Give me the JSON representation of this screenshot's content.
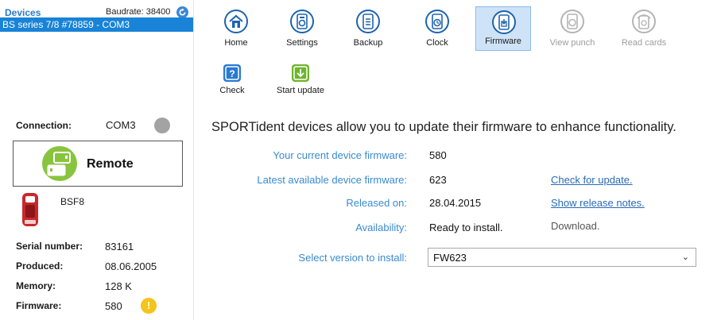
{
  "left_panel": {
    "devices_title": "Devices",
    "baudrate_label": "Baudrate: 38400",
    "selected_device": "BS series 7/8 #78859 - COM3",
    "connection": {
      "label": "Connection:",
      "value": "COM3",
      "status_color": "#a3a3a3"
    },
    "mode_label": "Remote",
    "device_model": "BSF8",
    "info": {
      "serial_label": "Serial number:",
      "serial_value": "83161",
      "produced_label": "Produced:",
      "produced_value": "08.06.2005",
      "memory_label": "Memory:",
      "memory_value": "128 K",
      "firmware_label": "Firmware:",
      "firmware_value": "580",
      "warning_symbol": "!"
    }
  },
  "toolbar": {
    "items": [
      {
        "label": "Home",
        "icon": "home-icon",
        "state": "normal"
      },
      {
        "label": "Settings",
        "icon": "settings-icon",
        "state": "normal"
      },
      {
        "label": "Backup",
        "icon": "backup-icon",
        "state": "normal"
      },
      {
        "label": "Clock",
        "icon": "clock-icon",
        "state": "normal"
      },
      {
        "label": "Firmware",
        "icon": "firmware-icon",
        "state": "active"
      },
      {
        "label": "View punch",
        "icon": "view-punch-icon",
        "state": "disabled"
      },
      {
        "label": "Read cards",
        "icon": "read-cards-icon",
        "state": "disabled"
      }
    ]
  },
  "subtoolbar": {
    "check_label": "Check",
    "start_update_label": "Start update"
  },
  "main": {
    "description": "SPORTident devices allow you to update their firmware to enhance functionality.",
    "current_fw_label": "Your current device firmware:",
    "current_fw_value": "580",
    "latest_fw_label": "Latest available device firmware:",
    "latest_fw_value": "623",
    "check_link": "Check for update.",
    "released_label": "Released on:",
    "released_value": "28.04.2015",
    "release_notes_link": "Show release notes.",
    "availability_label": "Availability:",
    "availability_value": "Ready to install.",
    "download_label": "Download.",
    "select_label": "Select version to install:",
    "select_value": "FW623"
  },
  "colors": {
    "accent": "#1883d7",
    "label_blue": "#3a8ad0",
    "green": "#8ac43f",
    "warning": "#f5c418",
    "device_red": "#c8282c"
  }
}
